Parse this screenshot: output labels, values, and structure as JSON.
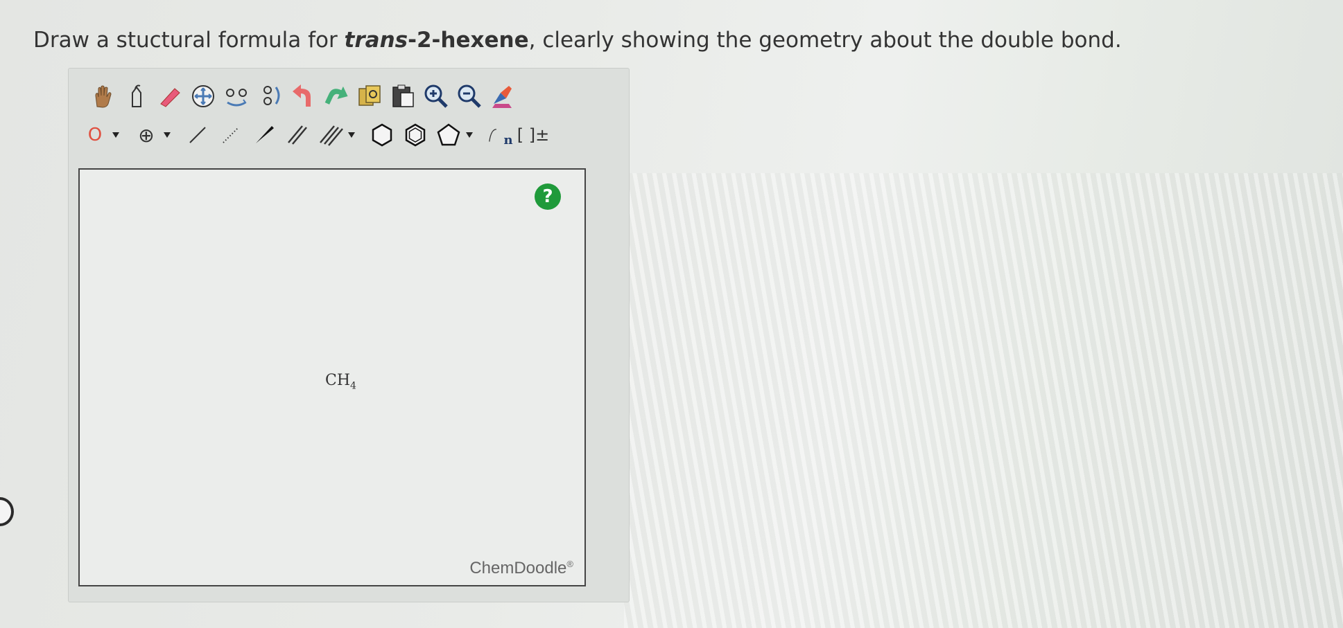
{
  "question": {
    "prefix": "Draw a stuctural formula for ",
    "compound_italic": "trans",
    "compound_rest": "-2-hexene",
    "suffix": ", clearly showing the geometry about the double bond."
  },
  "toolbar_top": [
    {
      "name": "hand-icon"
    },
    {
      "name": "lasso-icon"
    },
    {
      "name": "eraser-icon"
    },
    {
      "name": "center-icon"
    },
    {
      "name": "flip-horizontal-icon"
    },
    {
      "name": "flip-vertical-icon"
    },
    {
      "name": "undo-icon"
    },
    {
      "name": "redo-icon"
    },
    {
      "name": "copy-icon"
    },
    {
      "name": "paste-icon"
    },
    {
      "name": "zoom-in-icon"
    },
    {
      "name": "zoom-out-icon"
    },
    {
      "name": "clean-icon"
    }
  ],
  "toolbar_bottom": {
    "atom_label": "O",
    "charge_label": "⊕",
    "brackets_label": "[ ]±",
    "repeat_label": "n"
  },
  "canvas": {
    "molecule": "CH",
    "molecule_sub": "4",
    "help_label": "?",
    "brand": "ChemDoodle",
    "brand_mark": "®"
  },
  "colors": {
    "help": "#1f9a3a",
    "atom_o": "#e05040",
    "undo": "#e86a6a",
    "redo": "#45b17a"
  }
}
